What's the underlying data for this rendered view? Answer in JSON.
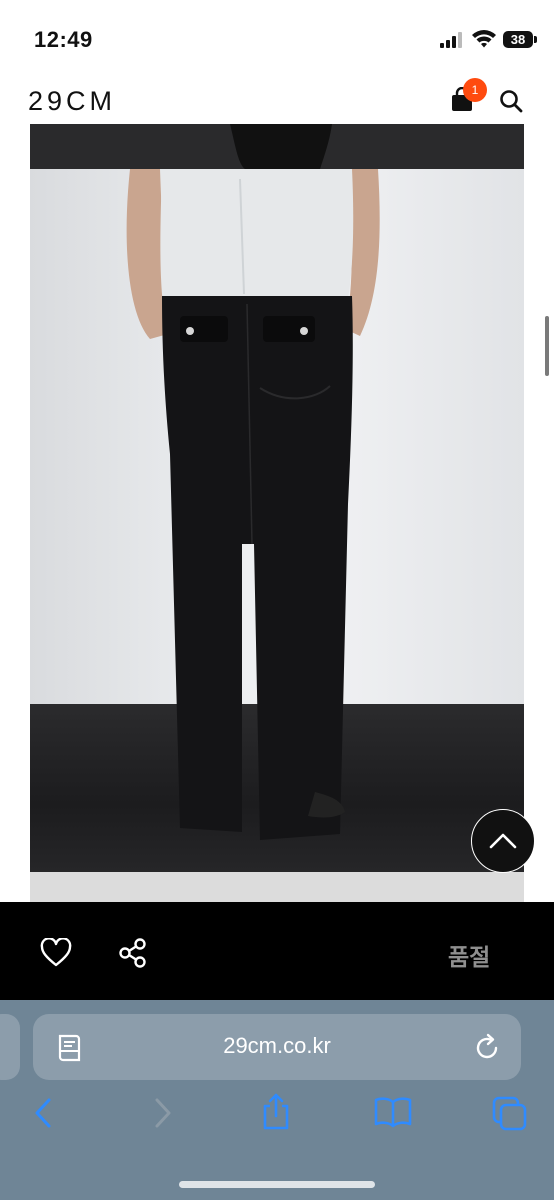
{
  "status_bar": {
    "time": "12:49",
    "battery": "38"
  },
  "header": {
    "logo": "29CM",
    "cart_count": "1",
    "badge_color": "#ff4b0f"
  },
  "product_image": {
    "description_icon": "product-photo"
  },
  "product_bar": {
    "status_label": "품절"
  },
  "browser": {
    "url": "29cm.co.kr"
  },
  "icons": {
    "cart": "shopping-bag-icon",
    "search": "search-icon",
    "scroll_top": "chevron-up-icon",
    "like": "heart-icon",
    "share": "share-icon",
    "reader": "reader-icon",
    "reload": "reload-icon",
    "back": "back-chevron-icon",
    "forward": "forward-chevron-icon",
    "share_sheet": "share-sheet-icon",
    "bookmarks": "bookmarks-icon",
    "tabs": "tabs-icon"
  }
}
